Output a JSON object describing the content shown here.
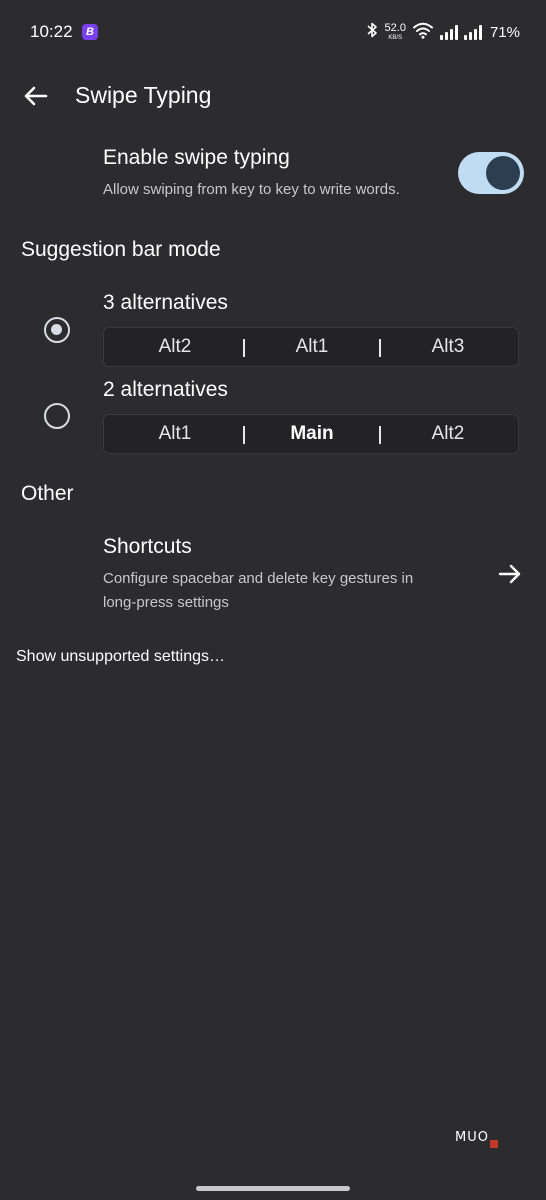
{
  "status_bar": {
    "time": "10:22",
    "app_badge": "B",
    "bluetooth_icon": "bluetooth-icon",
    "speed_value": "52.0",
    "speed_unit": "KB/S",
    "wifi_icon": "wifi-icon",
    "signal_icon": "cell-signal-icon",
    "battery": "71%"
  },
  "app_bar": {
    "title": "Swipe Typing",
    "back_icon": "arrow-back-icon"
  },
  "enable_swipe": {
    "title": "Enable swipe typing",
    "summary": "Allow swiping from key to key to write words.",
    "checked": true
  },
  "suggestion_bar": {
    "header": "Suggestion bar mode",
    "options": [
      {
        "label": "3 alternatives",
        "selected": true,
        "preview": [
          "Alt2",
          "Alt1",
          "Alt3"
        ]
      },
      {
        "label": "2 alternatives",
        "selected": false,
        "preview": [
          "Alt1",
          "Main",
          "Alt2"
        ]
      }
    ]
  },
  "other": {
    "header": "Other",
    "shortcuts": {
      "title": "Shortcuts",
      "summary_line1": "Configure spacebar and delete key gestures in",
      "summary_line2": "long-press settings",
      "icon": "arrow-forward-icon"
    }
  },
  "show_unsupported": "Show unsupported settings…",
  "watermark": "MUO",
  "colors": {
    "background": "#2c2c2e",
    "switch_track": "#bfdcf2",
    "switch_thumb": "#2d3e50",
    "radio": "#d6dbe4",
    "badge": "#7b3ff2"
  }
}
